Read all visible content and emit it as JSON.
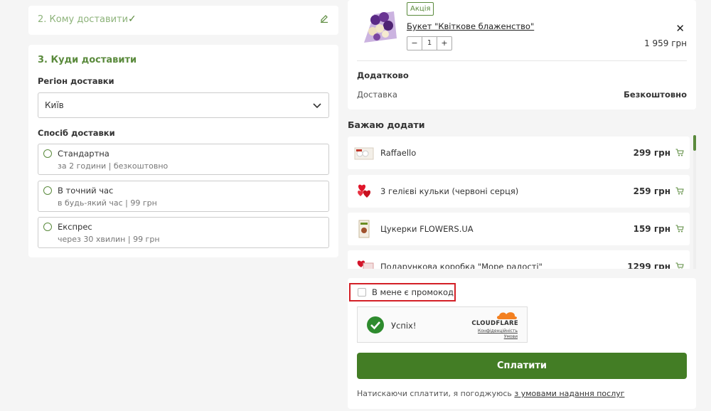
{
  "step2": {
    "title": "2. Кому доставити"
  },
  "step3": {
    "title": "3. Куди доставити",
    "region_label": "Регіон доставки",
    "region_value": "Київ",
    "method_label": "Спосіб доставки",
    "options": [
      {
        "name": "Стандартна",
        "sub": "за 2 години | безкоштовно"
      },
      {
        "name": "В точний час",
        "sub": "в будь-який час | 99 грн"
      },
      {
        "name": "Експрес",
        "sub": "через 30 хвилин | 99 грн"
      }
    ]
  },
  "cart": {
    "badge": "Акція",
    "product_name": "Букет \"Квіткове блаженство\"",
    "qty": "1",
    "price": "1 959 грн",
    "extra_heading": "Додатково",
    "delivery_label": "Доставка",
    "delivery_value": "Безкоштовно"
  },
  "wish": {
    "heading": "Бажаю додати",
    "items": [
      {
        "name": "Raffaello",
        "price": "299 грн"
      },
      {
        "name": "3 гелієві кульки (червоні серця)",
        "price": "259 грн"
      },
      {
        "name": "Цукерки FLOWERS.UA",
        "price": "159 грн"
      },
      {
        "name": "Подарункова коробка \"Море радості\"",
        "price": "1299 грн"
      }
    ]
  },
  "payment": {
    "promo_label": "В мене є промокод",
    "captcha_status": "Успіх!",
    "captcha_brand": "CLOUDFLARE",
    "captcha_privacy": "Конфіденційність",
    "captcha_terms": "Умови",
    "pay_button": "Сплатити",
    "terms_prefix": "Натискаючи сплатити, я погоджуюсь ",
    "terms_link": "з умовами надання послуг"
  },
  "colors": {
    "accent": "#437d25",
    "accent_light": "#5a8a3c",
    "highlight": "#d32027"
  }
}
